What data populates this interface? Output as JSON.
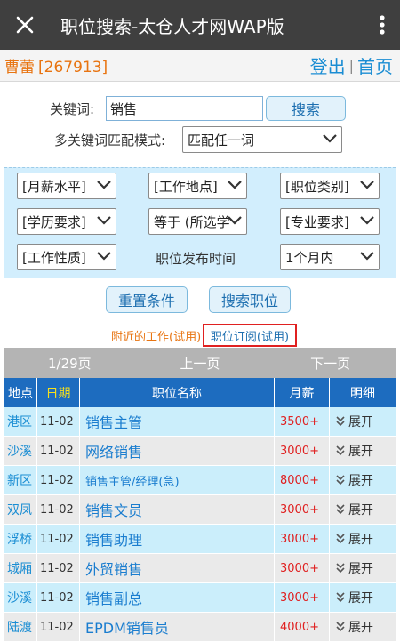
{
  "appbar": {
    "title": "职位搜索-太仓人才网WAP版"
  },
  "user": {
    "name": "曹蕾",
    "id": "[267913]",
    "logout": "登出",
    "separator": "|",
    "home": "首页"
  },
  "search": {
    "keyword_label": "关键词:",
    "keyword_value": "销售",
    "search_button": "搜索",
    "match_label": "多关键词匹配模式:",
    "match_value": "匹配任一词"
  },
  "filters": {
    "salary": "[月薪水平]",
    "location": "[工作地点]",
    "category": "[职位类别]",
    "education": "[学历要求]",
    "equals": "等于 (所选学",
    "major": "[专业要求]",
    "nature": "[工作性质]",
    "publish_label": "职位发布时间",
    "publish_value": "1个月内"
  },
  "actions": {
    "reset": "重置条件",
    "search_jobs": "搜索职位"
  },
  "links": {
    "nearby": "附近的工作(试用)",
    "subscribe": "职位订阅(试用)"
  },
  "pager": {
    "page": "1/29页",
    "prev": "上一页",
    "next": "下一页"
  },
  "table": {
    "headers": {
      "location": "地点",
      "date": "日期",
      "title": "职位名称",
      "salary": "月薪",
      "detail": "明细"
    },
    "rows": [
      {
        "location": "港区",
        "date": "11-02",
        "title": "销售主管",
        "salary": "3500+",
        "detail": "展开"
      },
      {
        "location": "沙溪",
        "date": "11-02",
        "title": "网络销售",
        "salary": "3000+",
        "detail": "展开"
      },
      {
        "location": "新区",
        "date": "11-02",
        "title": "销售主管/经理(急)",
        "salary": "8000+",
        "detail": "展开"
      },
      {
        "location": "双凤",
        "date": "11-02",
        "title": "销售文员",
        "salary": "3000+",
        "detail": "展开"
      },
      {
        "location": "浮桥",
        "date": "11-02",
        "title": "销售助理",
        "salary": "3000+",
        "detail": "展开"
      },
      {
        "location": "城厢",
        "date": "11-02",
        "title": "外贸销售",
        "salary": "3000+",
        "detail": "展开"
      },
      {
        "location": "沙溪",
        "date": "11-02",
        "title": "销售副总",
        "salary": "3000+",
        "detail": "展开"
      },
      {
        "location": "陆渡",
        "date": "11-02",
        "title": "EPDM销售员",
        "salary": "4000+",
        "detail": "展开"
      }
    ]
  },
  "colors": {
    "appbar": "#3f3f3f",
    "accent_blue": "#1a8dd3",
    "orange": "#e87411",
    "red": "#e02020",
    "header_blue": "#1d6cbf"
  },
  "icons": {
    "close": "close-icon",
    "more": "more-vert-icon",
    "chevron": "chevron-down-icon",
    "expand": "double-chevron-down-icon"
  }
}
